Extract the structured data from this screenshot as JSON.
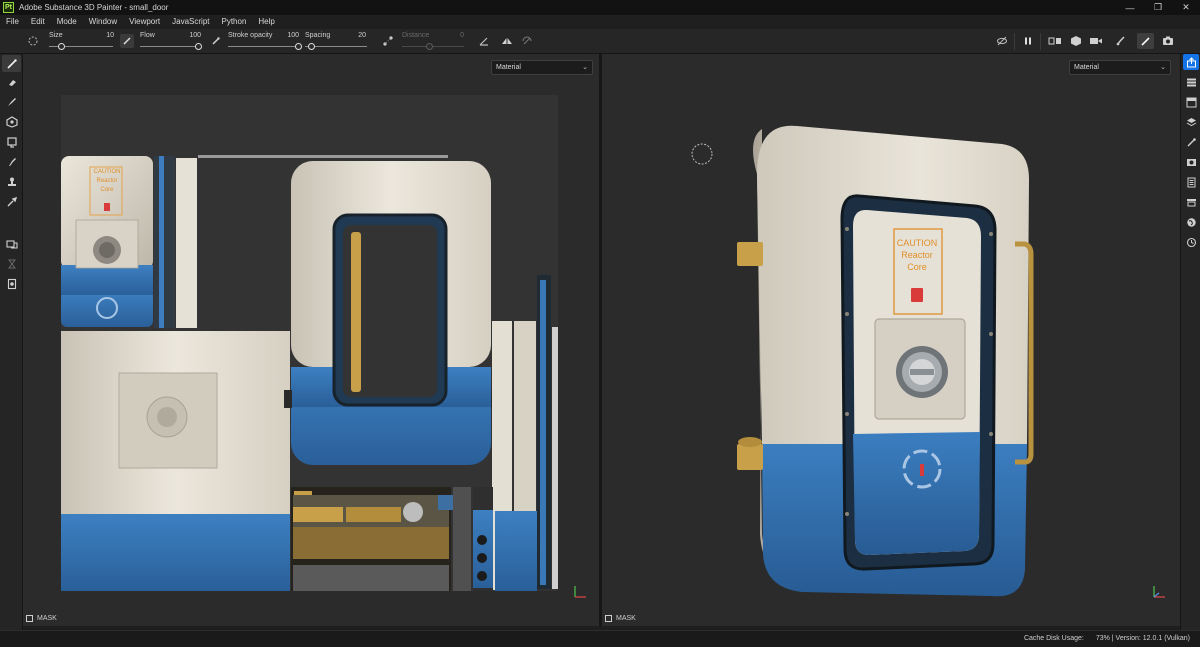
{
  "window": {
    "title": "Adobe Substance 3D Painter - small_door",
    "logo": "Pt",
    "controls": [
      "—",
      "❐",
      "✕"
    ]
  },
  "menu": [
    "File",
    "Edit",
    "Mode",
    "Window",
    "Viewport",
    "JavaScript",
    "Python",
    "Help"
  ],
  "toolbar": {
    "size_label": "Size",
    "size_value": "10",
    "flow_label": "Flow",
    "flow_value": "100",
    "stroke_label": "Stroke opacity",
    "stroke_value": "100",
    "spacing_label": "Spacing",
    "spacing_value": "20",
    "distance_label": "Distance",
    "distance_value": "0"
  },
  "sliders": {
    "size_fraction": 0.2,
    "flow_fraction": 1.0,
    "stroke_fraction": 1.0,
    "spacing_fraction": 0.1,
    "distance_fraction": 0.45
  },
  "left_tools": [
    "paint-brush-icon",
    "eraser-icon",
    "projection-icon",
    "polygon-fill-icon",
    "smudge-icon",
    "clone-icon",
    "color-picker-icon",
    "bake-icon",
    "history-icon",
    "geometry-mask-icon"
  ],
  "right_panels": [
    "share-icon",
    "layers-icon",
    "texture-set-icon",
    "stack-icon",
    "brush-settings-icon",
    "display-settings-icon",
    "properties-icon",
    "shelf-icon",
    "environment-icon",
    "history-icon"
  ],
  "viewport_2d": {
    "channel": "Material",
    "mask": "MASK"
  },
  "viewport_3d": {
    "channel": "Material",
    "mask": "MASK"
  },
  "uv_labels": {
    "caution": "CAUTION",
    "reactor": "Reactor",
    "core": "Core"
  },
  "door_labels": {
    "caution": "CAUTION",
    "reactor": "Reactor",
    "core": "Core"
  },
  "colors": {
    "accent": "#1473e6",
    "door_white": "#e8e2d6",
    "door_blue": "#2f6fb1",
    "caution_orange": "#e0902b",
    "brass": "#c9a04a"
  },
  "status": {
    "cache_label": "Cache Disk Usage:",
    "cache_value": "73%",
    "version": "Version: 12.0.1 (Vulkan)"
  }
}
